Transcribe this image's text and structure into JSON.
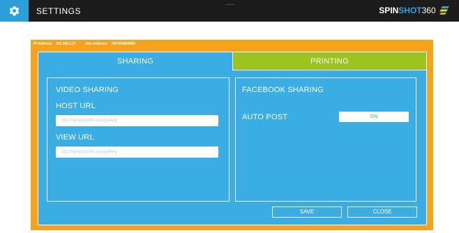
{
  "header": {
    "title": "SETTINGS",
    "brand": {
      "part1": "SPIN",
      "part2": "SHOT",
      "part3": "360"
    }
  },
  "info": {
    "ip_label": "IP Address:",
    "ip_value": "192.168.1.37",
    "mac_label": "Mac Address:",
    "mac_value": "74F0946B4858"
  },
  "tabs": {
    "sharing": "SHARING",
    "printing": "PRINTING"
  },
  "video_sharing": {
    "heading": "VIDEO SHARING",
    "host_label": "HOST URL",
    "host_placeholder": "http://spinshot360.com/gallery",
    "view_label": "VIEW URL",
    "view_placeholder": "http://spinshot360.com/gallery"
  },
  "facebook_sharing": {
    "heading": "FACEBOOK SHARING",
    "auto_post_label": "AUTO POST",
    "auto_post_value": "ON"
  },
  "buttons": {
    "save": "SAVE",
    "close": "CLOSE"
  },
  "colors": {
    "accent_blue": "#3aaee4",
    "frame_orange": "#f4a31a",
    "tab_green": "#9cc320",
    "topbar": "#1c1c1c"
  }
}
